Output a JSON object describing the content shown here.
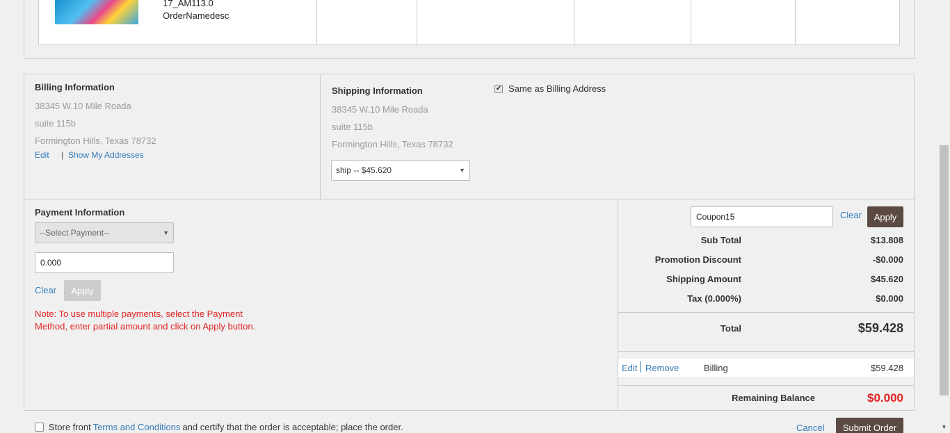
{
  "order_item": {
    "code": "17_AM113.0",
    "description": "OrderNamedesc"
  },
  "billing": {
    "title": "Billing Information",
    "address_line1": "38345 W.10 Mile Roada",
    "address_line2": "suite 115b",
    "city_state_zip": "Formington Hills, Texas 78732",
    "edit_label": "Edit",
    "separator": "|",
    "show_addresses_label": "Show My Addresses"
  },
  "shipping": {
    "title": "Shipping Information",
    "same_as_billing_label": "Same as Billing Address",
    "same_as_billing_checked": true,
    "address_line1": "38345 W.10 Mile Roada",
    "address_line2": "suite 115b",
    "city_state_zip": "Formington Hills, Texas 78732",
    "method_selected": "ship -- $45.620"
  },
  "payment": {
    "title": "Payment Information",
    "select_value": "--Select Payment--",
    "amount_value": "0.000",
    "clear_label": "Clear",
    "apply_label": "Apply",
    "note": "Note: To use multiple payments, select the Payment Method, enter partial amount and click on Apply button."
  },
  "summary": {
    "coupon_value": "Coupon15",
    "clear_label": "Clear",
    "apply_label": "Apply",
    "subtotal_label": "Sub Total",
    "subtotal_value": "$13.808",
    "promo_label": "Promotion Discount",
    "promo_value": "-$0.000",
    "shipping_label": "Shipping Amount",
    "shipping_value": "$45.620",
    "tax_label": "Tax (0.000%)",
    "tax_value": "$0.000",
    "total_label": "Total",
    "total_value": "$59.428",
    "payment_row": {
      "edit_label": "Edit",
      "remove_label": "Remove",
      "method": "Billing",
      "amount": "$59.428"
    },
    "remaining_label": "Remaining Balance",
    "remaining_value": "$0.000"
  },
  "footer": {
    "agree_prefix": "Store front",
    "terms_label": "Terms and Conditions",
    "agree_suffix": "and certify that the order is acceptable; place the order.",
    "cancel_label": "Cancel",
    "submit_label": "Submit Order"
  },
  "colors": {
    "accent_link": "#337ab7",
    "dark_button": "#5a4a42",
    "alert_red": "#e32222"
  }
}
